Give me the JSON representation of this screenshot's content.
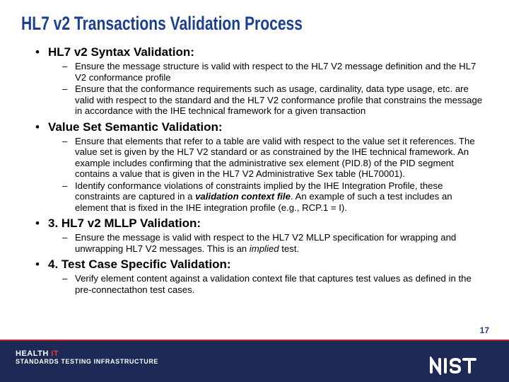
{
  "title": "HL7 v2 Transactions Validation Process",
  "sections": [
    {
      "heading": "HL7 v2 Syntax Validation:",
      "subs": [
        "Ensure the message structure is valid with respect to the HL7 V2 message definition and the HL7 V2 conformance profile",
        "Ensure that the conformance requirements such as usage, cardinality, data type usage, etc. are valid with respect to the standard and the HL7 V2 conformance profile that constrains the message in accordance with the IHE technical framework for a given transaction"
      ]
    },
    {
      "heading": "Value Set Semantic Validation:",
      "subs": [
        "Ensure that elements that refer to a table are valid with respect to the value set it references. The value set is given by the HL7 V2 standard or as constrained by the IHE technical framework.  An example includes confirming that the administrative sex element (PID.8) of the PID segment contains a value that is given in the HL7 V2 Administrative Sex table (HL70001).",
        "Identify conformance violations of constraints implied by the IHE Integration Profile, these constraints are captured in a <b class=\"embold\">validation context file</b>. An example of such a test includes an element that is fixed in the IHE integration profile (e.g., RCP.1 = I)."
      ]
    },
    {
      "heading": "3. HL7 v2 MLLP Validation:",
      "subs": [
        "Ensure the message is valid with respect to the HL7 V2 MLLP specification for wrapping and unwrapping HL7 V2 messages. This is an <em class=\"italic\">implied</em> test."
      ]
    },
    {
      "heading": "4. Test Case Specific Validation:",
      "subs": [
        "Verify element content against a validation context file that captures test values as defined in the pre-connectathon test cases."
      ]
    }
  ],
  "footer": {
    "brand_line1_a": "HEALTH ",
    "brand_line1_b": "IT",
    "brand_line2": "STANDARDS TESTING INFRASTRUCTURE",
    "nist": "NIST"
  },
  "page_number": "17"
}
